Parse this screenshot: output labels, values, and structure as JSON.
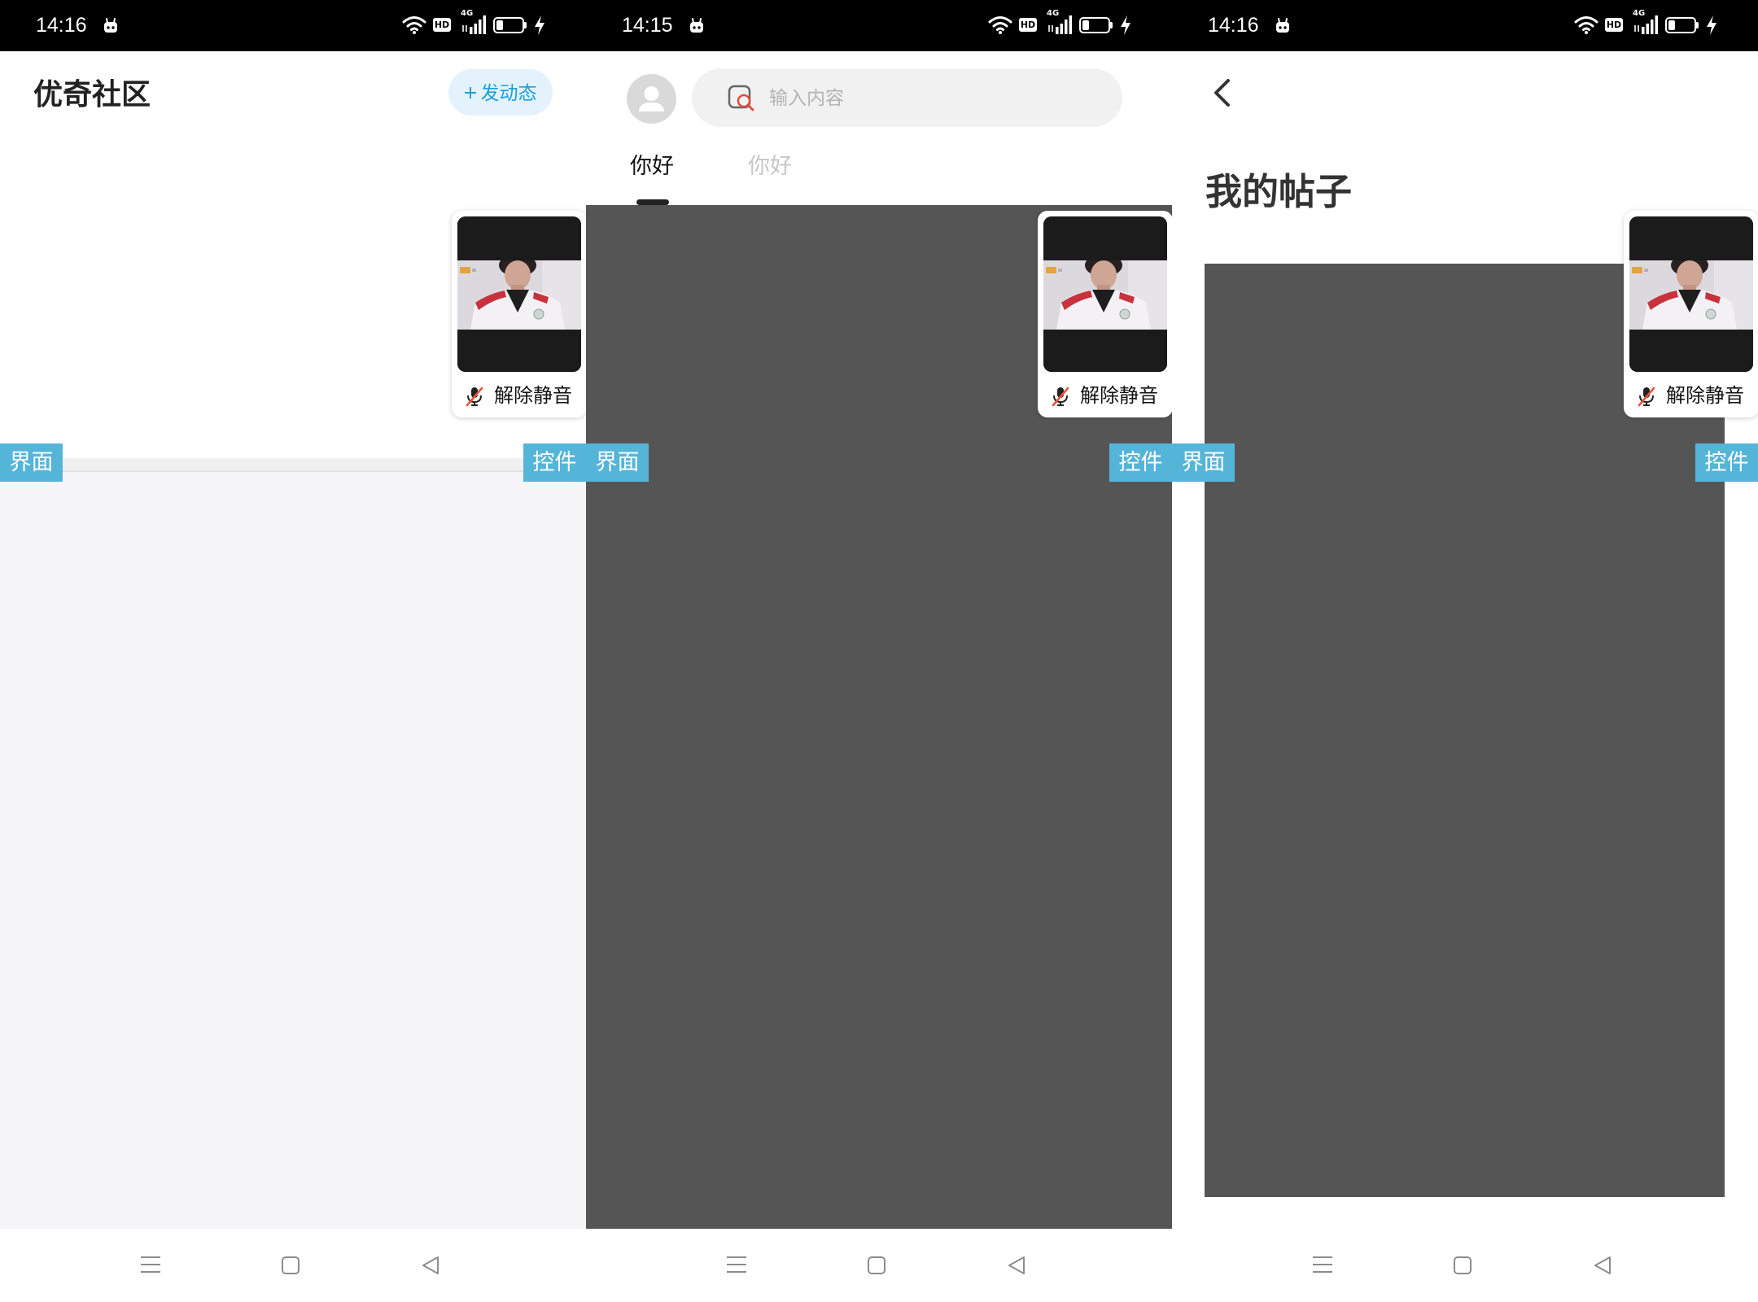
{
  "colors": {
    "status_bar_bg": "#000000",
    "accent": "#1a9fd9",
    "accent_bg": "#e4f3fb",
    "tag_bg": "#55b5d9",
    "dark_content": "#555555",
    "light_content": "#f5f5f7",
    "mute_slash": "#e8553a"
  },
  "screens": [
    {
      "status_bar": {
        "time": "14:16",
        "hd_label": "HD",
        "network_label": "4G",
        "battery_level": 0.25,
        "icons": [
          "app-notification-icon",
          "wifi-icon",
          "hd-icon",
          "signal-icon",
          "battery-icon",
          "charging-icon"
        ]
      },
      "header": {
        "title": "优奇社区",
        "post_button": {
          "icon": "plus-icon",
          "label": "发动态"
        }
      },
      "floating_video": {
        "mute_icon": "mic-off-icon",
        "mute_label": "解除静音"
      },
      "debug_tags": [
        "界面",
        "控件"
      ],
      "nav_bar": {
        "icons": [
          "menu-icon",
          "home-icon",
          "back-icon"
        ]
      }
    },
    {
      "status_bar": {
        "time": "14:15",
        "hd_label": "HD",
        "network_label": "4G",
        "battery_level": 0.25,
        "icons": [
          "app-notification-icon",
          "wifi-icon",
          "hd-icon",
          "signal-icon",
          "battery-icon",
          "charging-icon"
        ]
      },
      "header": {
        "avatar_icon": "avatar-icon",
        "search": {
          "icon": "search-icon",
          "placeholder": "输入内容",
          "value": ""
        }
      },
      "tabs": [
        {
          "label": "你好",
          "active": true
        },
        {
          "label": "你好",
          "active": false
        }
      ],
      "floating_video": {
        "mute_icon": "mic-off-icon",
        "mute_label": "解除静音"
      },
      "debug_tags": [
        "界面",
        "控件"
      ],
      "nav_bar": {
        "icons": [
          "menu-icon",
          "home-icon",
          "back-icon"
        ]
      }
    },
    {
      "status_bar": {
        "time": "14:16",
        "hd_label": "HD",
        "network_label": "4G",
        "battery_level": 0.25,
        "icons": [
          "app-notification-icon",
          "wifi-icon",
          "hd-icon",
          "signal-icon",
          "battery-icon",
          "charging-icon"
        ]
      },
      "header": {
        "back_icon": "chevron-left-icon",
        "title": "我的帖子"
      },
      "floating_video": {
        "mute_icon": "mic-off-icon",
        "mute_label": "解除静音"
      },
      "debug_tags": [
        "界面",
        "控件"
      ],
      "nav_bar": {
        "icons": [
          "menu-icon",
          "home-icon",
          "back-icon"
        ]
      }
    }
  ]
}
